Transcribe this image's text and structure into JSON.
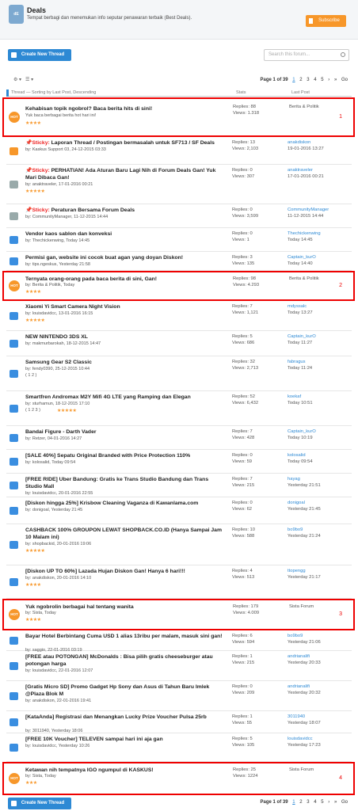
{
  "header": {
    "logo": "dE",
    "title": "Deals",
    "description": "Tempat berbagi dan menemukan info seputar penawaran terbaik (Best Deals).",
    "subscribe": "Subscribe"
  },
  "top": {
    "create": "Create New Thread",
    "search_placeholder": "Search this forum...",
    "page_of": "Page 1 of 39",
    "pages": [
      "1",
      "2",
      "3",
      "4",
      "5"
    ],
    "go": "Go"
  },
  "columns": {
    "thread": "Thread — Sorting by Last Post, Descending",
    "stats": "Stats",
    "lastpost": "Last Post"
  },
  "hot_label": "HOT",
  "highlight": [
    {
      "num": "1",
      "title": "Kehabisan topik ngobrol? Baca berita hits di sini!",
      "sub": "Yuk baca berbagai berita hot hari ini!",
      "stars": "★★★★",
      "replies": "Replies: 88",
      "views": "Views: 1.318",
      "lp1": "Berita & Politik",
      "lp2": ""
    },
    {
      "num": "2",
      "title": "Ternyata orang-orang pada baca berita di sini, Gan!",
      "sub": "by: Berita & Politik, Today",
      "stars": "★★★★",
      "replies": "Replies: 98",
      "views": "Views: 4.293",
      "lp1": "Berita & Politik",
      "lp2": ""
    },
    {
      "num": "3",
      "title": "Yuk ngobrolin berbagai hal tentang wanita",
      "sub": "by: Sista, Today",
      "stars": "★★★★",
      "replies": "Replies: 179",
      "views": "Views: 4.009",
      "lp1": "Sista Forum",
      "lp2": ""
    },
    {
      "num": "4",
      "title": "Ketawan nih tempatnya IGO ngumpul di KASKUS!",
      "sub": "by: Sista, Today",
      "stars": "★★★",
      "replies": "Replies: 25",
      "views": "Views: 1224",
      "lp1": "Sista Forum",
      "lp2": ""
    }
  ],
  "threads": [
    {
      "title": "Sticky: Laporan Thread / Postingan bermasalah untuk SF713 / SF Deals",
      "by": "by: Kaskus Support 03, 24-12-2015 03:33",
      "stars": "",
      "replies": "Replies: 13",
      "views": "Views: 2,103",
      "lp1": "anakdiskon",
      "lp2": "19-01-2016 13:27"
    },
    {
      "title": "Sticky: PERHATIAN! Ada Aturan Baru Lagi Nih di Forum Deals Gan! Yuk Mari Dibaca Gan!",
      "by": "by: anaktraveler, 17-01-2016 00:21",
      "stars": "★★★★★",
      "replies": "Replies: 0",
      "views": "Views: 307",
      "lp1": "anaktraveler",
      "lp2": "17-01-2016 00:21"
    },
    {
      "title": "Sticky: Peraturan Bersama Forum Deals",
      "by": "by: CommunityManager, 11-12-2015 14:44",
      "stars": "",
      "replies": "Replies: 0",
      "views": "Views: 3,599",
      "lp1": "CommunityManager",
      "lp2": "11-12-2015 14:44"
    },
    {
      "title": "Vendor kaos sablon dan konveksi",
      "by": "by: Thechickenwing, Today 14:45",
      "stars": "",
      "replies": "Replies: 0",
      "views": "Views: 1",
      "lp1": "Thechickenwing",
      "lp2": "Today 14:45"
    },
    {
      "title": "Permisi gan, website ini cocok buat agan yang doyan Diskon!",
      "by": "by: tips.ngeskus, Yesterday 21:58",
      "stars": "",
      "replies": "Replies: 3",
      "views": "Views: 135",
      "lp1": "Captain_kurO",
      "lp2": "Today 14:40"
    },
    {
      "title": "Xiaomi Yi Smart Camera Night Vision",
      "by": "by: louisdavidcc, 13-01-2016 16:15",
      "stars": "★★★★★",
      "replies": "Replies: 7",
      "views": "Views: 1,121",
      "lp1": "mdyssalc",
      "lp2": "Today 13:27"
    },
    {
      "title": "NEW NINTENDO 3DS XL",
      "by": "by: makmurbarokah, 18-12-2015 14:47",
      "stars": "",
      "replies": "Replies: 5",
      "views": "Views: 686",
      "lp1": "Captain_kurO",
      "lp2": "Today 11:27"
    },
    {
      "title": "Samsung Gear S2 Classic",
      "by": "by: fendy0390, 25-12-2015 10:44",
      "stars": "",
      "pages": "( 1 2 )",
      "replies": "Replies: 32",
      "views": "Views: 2,713",
      "lp1": "fabragus",
      "lp2": "Today 11:24"
    },
    {
      "title": "Smartfren Andromax M2Y Mifi 4G LTE yang Ramping dan Elegan",
      "by": "by: sturhamun, 18-12-2015 17:10",
      "stars": "★★★★★",
      "pages": "( 1 2 3 )",
      "replies": "Replies: 52",
      "views": "Views: 6,432",
      "lp1": "koekaf",
      "lp2": "Today 10:51"
    },
    {
      "title": "Bandai Figure - Darth Vader",
      "by": "by: Retzer, 04-01-2016 14:27",
      "stars": "",
      "replies": "Replies: 7",
      "views": "Views: 428",
      "lp1": "Captain_kurO",
      "lp2": "Today 10:19"
    },
    {
      "title": "[SALE 40%] Sepatu Original Branded with Price Protection 110%",
      "by": "by: kolosalid, Today 09:54",
      "stars": "",
      "replies": "Replies: 0",
      "views": "Views: 59",
      "lp1": "kolosalid",
      "lp2": "Today 09:54"
    },
    {
      "title": "[FREE RIDE] Uber Bandung: Gratis ke Trans Studio Bandung dan Trans Studio Mall",
      "by": "by: louisdavidcc, 20-01-2016 22:55",
      "stars": "",
      "replies": "Replies: 7",
      "views": "Views: 215",
      "lp1": "hayag",
      "lp2": "Yesterday 21:51"
    },
    {
      "title": "[Diskon hingga 25%] Krisbow Cleaning Vaganza di Kawanlama.com",
      "by": "by: donigoal, Yesterday 21:45",
      "stars": "",
      "replies": "Replies: 0",
      "views": "Views: 62",
      "lp1": "donigoal",
      "lp2": "Yesterday 21:45"
    },
    {
      "title": "CASHBACK 100% GROUPON LEWAT SHOPBACK.CO.ID (Hanya Sampai Jam 10 Malam ini)",
      "by": "by: shopbackid, 20-01-2016 19:06",
      "stars": "★★★★★",
      "replies": "Replies: 10",
      "views": "Views: 588",
      "lp1": "bo9bo9",
      "lp2": "Yesterday 21:24"
    },
    {
      "title": "[Diskon UP TO 60%] Lazada Hujan Diskon Gan! Hanya 6 hari!!!",
      "by": "by: anakdiskon, 20-01-2016 14:10",
      "stars": "★★★★",
      "replies": "Replies: 4",
      "views": "Views: 513",
      "lp1": "ttopengg",
      "lp2": "Yesterday 21:17"
    },
    {
      "title": "Bayar Hotel Berbintang Cuma USD 1 alias 13ribu per malam, masuk sini gan!",
      "by": "by: saggio, 22-01-2016 03:19",
      "stars": "",
      "replies": "Replies: 6",
      "views": "Views: 594",
      "lp1": "bo9bo9",
      "lp2": "Yesterday 21:06"
    },
    {
      "title": "[FREE atau POTONGAN] McDonalds : Bisa pilih gratis cheeseburger atau potongan harga",
      "by": "by: louisdavidcc, 22-01-2016 12:07",
      "stars": "",
      "replies": "Replies: 1",
      "views": "Views: 215",
      "lp1": "andrianalifi",
      "lp2": "Yesterday 20:33"
    },
    {
      "title": "[Gratis Micro SD] Promo Gadget Hp Sony dan Asus di Tahun Baru Imlek @Plaza Blok M",
      "by": "by: anakdiskon, 22-01-2016 19:41",
      "stars": "",
      "replies": "Replies: 0",
      "views": "Views: 209",
      "lp1": "andrianalifi",
      "lp2": "Yesterday 20:32"
    },
    {
      "title": "[KataAnda] Registrasi dan Menangkan Lucky Prize Voucher Pulsa 25rb",
      "by": "by: 3011940, Yesterday 18:06",
      "stars": "",
      "replies": "Replies: 1",
      "views": "Views: 55",
      "lp1": "3011940",
      "lp2": "Yesterday 18:07"
    },
    {
      "title": "[FREE 10K Voucher] TELEVEN sampai hari ini aja gan",
      "by": "by: louisdavidcc, Yesterday 10:26",
      "stars": "",
      "replies": "Replies: 5",
      "views": "Views: 105",
      "lp1": "louisdavidcc",
      "lp2": "Yesterday 17:23"
    }
  ],
  "colors": {
    "accent": "#2d89d4",
    "hot": "#f7972a",
    "highlight": "#ee0000"
  }
}
